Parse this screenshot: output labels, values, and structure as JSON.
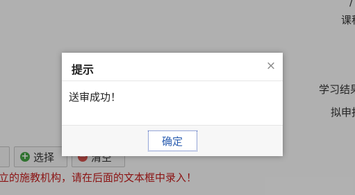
{
  "background": {
    "top_mark": "/",
    "label_course": "课程",
    "label_study": "学习结果",
    "label_apply": "拟申报",
    "partial_button_label": "",
    "select_button_label": "选择",
    "clear_button_label": "清空",
    "warning_text": "立的施教机构，请在后面的文本框中录入！",
    "warning_color": "#c81d1d"
  },
  "dialog": {
    "title": "提示",
    "close_symbol": "×",
    "message": "送审成功！",
    "confirm_label": "确定",
    "confirm_color": "#2a5db0"
  },
  "icons": {
    "select": "plus-circle-icon",
    "clear": "minus-circle-icon",
    "close": "close-icon"
  }
}
